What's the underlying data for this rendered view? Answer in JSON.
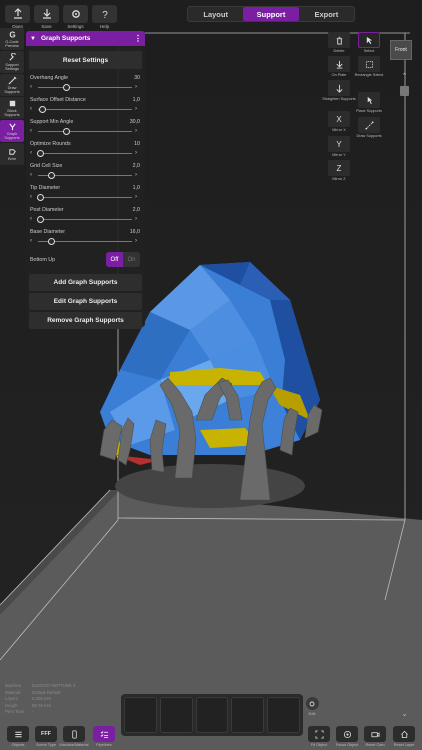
{
  "toolbar": {
    "items": [
      {
        "label": "Open",
        "icon": "upload-icon"
      },
      {
        "label": "Save",
        "icon": "download-icon"
      },
      {
        "label": "Settings",
        "icon": "gear-icon"
      },
      {
        "label": "Help",
        "icon": "question-icon"
      }
    ]
  },
  "mode_tabs": {
    "layout": "Layout",
    "support": "Support",
    "export": "Export",
    "active": "Support"
  },
  "sidebar": {
    "items": [
      {
        "label": "G-Code Preview",
        "icon": "g-icon"
      },
      {
        "label": "Support Settings",
        "icon": "wrench-icon"
      },
      {
        "label": "Draw Supports",
        "icon": "pen-icon"
      },
      {
        "label": "Block Supports",
        "icon": "block-icon"
      },
      {
        "label": "Graph Supports",
        "icon": "graph-icon"
      },
      {
        "label": "Brim",
        "icon": "brim-icon"
      }
    ],
    "active": "Graph Supports"
  },
  "panel": {
    "title": "Graph Supports",
    "reset_label": "Reset Settings",
    "params": [
      {
        "label": "Overhang Angle",
        "value": "30",
        "fraction": 0.3
      },
      {
        "label": "Surface Offset Distance",
        "value": "1,0",
        "fraction": 0.05
      },
      {
        "label": "Support Min Angle",
        "value": "30,0",
        "fraction": 0.3
      },
      {
        "label": "Optimize Rounds",
        "value": "10",
        "fraction": 0.0
      },
      {
        "label": "Grid Cell Size",
        "value": "2,0",
        "fraction": 0.14
      },
      {
        "label": "Tip Diameter",
        "value": "1,0",
        "fraction": 0.0
      },
      {
        "label": "Post Diameter",
        "value": "2,0",
        "fraction": 0.0
      },
      {
        "label": "Base Diameter",
        "value": "16,0",
        "fraction": 0.14
      }
    ],
    "bottom_up": {
      "label": "Bottom Up",
      "off": "Off",
      "on": "On",
      "state": "Off"
    },
    "add_label": "Add Graph Supports",
    "edit_label": "Edit Graph Supports",
    "remove_label": "Remove Graph Supports"
  },
  "tools": {
    "delete": "Delete",
    "select": "Select",
    "on_plate": "On Plate",
    "rect_select": "Rectangle Select",
    "straighten": "Straighten Supports",
    "place_supports": "Place Supports",
    "mirror_x": "Mirror X",
    "draw_supports": "Draw Supports",
    "mirror_y": "Mirror Y",
    "mirror_z": "Mirror Z",
    "x_glyph": "X",
    "y_glyph": "Y",
    "z_glyph": "Z"
  },
  "view": {
    "cube_label": "Front"
  },
  "info": {
    "rows": [
      {
        "key": "Machine",
        "value": "ELEGOO NEPTUNE 4"
      },
      {
        "key": "Material",
        "value": "Default Default"
      },
      {
        "key": "Layers",
        "value": "0.200 mm"
      },
      {
        "key": "Height",
        "value": "89.76 mm"
      },
      {
        "key": "Print Time",
        "value": "-"
      }
    ]
  },
  "bottom": {
    "edit": "Edit",
    "objects": "Objects",
    "scene_type": "Scene Type",
    "machine_material": "Machine/Material",
    "pipelines": "Pipelines",
    "fit_object": "Fit Object",
    "focus_object": "Focus Object",
    "reset_cam": "Reset Cam",
    "reset_layer": "Reset Layer",
    "ff_glyph": "FFF"
  },
  "colors": {
    "accent": "#7b1fa2",
    "model_blue": "#3a7fd5",
    "support_gray": "#6a6a6a",
    "overhang_yellow": "#c8b400"
  }
}
